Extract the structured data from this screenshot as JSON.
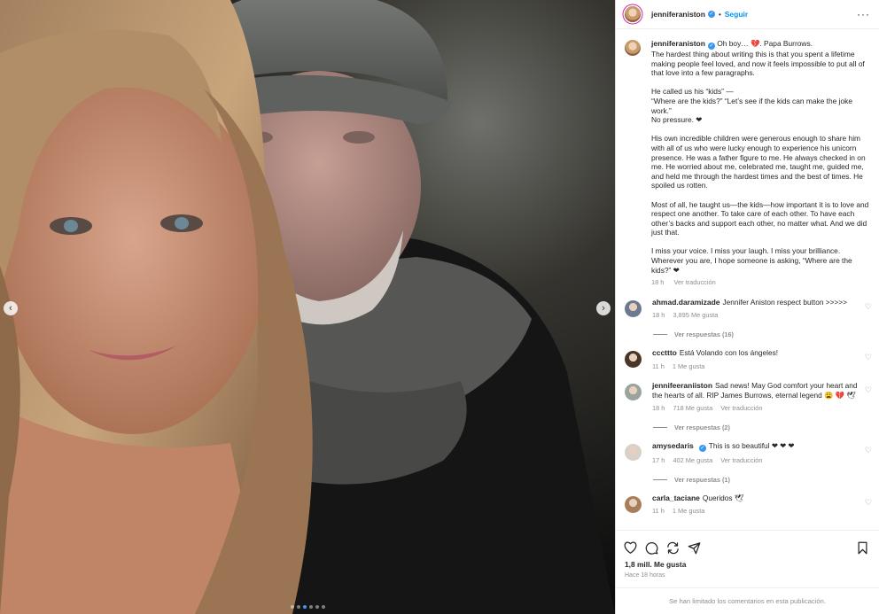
{
  "header": {
    "username": "jenniferaniston",
    "separator": "•",
    "follow_label": "Seguir",
    "more_label": "···"
  },
  "carousel": {
    "prev_label": "‹",
    "next_label": "›",
    "slide_count": 6,
    "active_slide": 2
  },
  "caption": {
    "username": "jenniferaniston",
    "paragraphs": [
      "Oh boy… 💔. Papa Burrows.\nThe hardest thing about writing this is that you spent a lifetime making people feel loved, and now it feels impossible to put all of that love into a few paragraphs.",
      "He called us his “kids” —\n“Where are the kids?” “Let’s see if the kids can make the joke work.”\nNo pressure. ❤",
      "His own incredible children were generous enough to share him with all of us who were lucky enough to experience his unicorn presence. He was a father figure to me. He always checked in on me. He worried about me, celebrated me, taught me, guided me, and held me through the hardest times and the best of times. He spoiled us rotten.",
      "Most of all, he taught us—the kids—how important it is to love and respect one another. To take care of each other. To have each other’s backs and support each other, no matter what. And we did just that.",
      "I miss your voice. I miss your laugh. I miss your brilliance. Wherever you are, I hope someone is asking, “Where are the kids?” ❤"
    ],
    "time": "18 h",
    "translate": "Ver traducción"
  },
  "comments": [
    {
      "username": "ahmad.daramizade",
      "text": "Jennifer Aniston respect button >>>>>",
      "time": "18 h",
      "likes": "3,895 Me gusta",
      "translate": "",
      "replies": "Ver respuestas (16)",
      "verified": false,
      "avatar_color": "#6b7a8f"
    },
    {
      "username": "cccttto",
      "text": "Está Volando con los ángeles!",
      "time": "11 h",
      "likes": "1 Me gusta",
      "translate": "",
      "replies": "",
      "verified": false,
      "avatar_color": "#4a3526"
    },
    {
      "username": "jennifeeraniiston",
      "text": "Sad news! May God comfort your heart and the hearts of all. RIP James Burrows, eternal legend 😩 💔 🕊",
      "time": "18 h",
      "likes": "718 Me gusta",
      "translate": "Ver traducción",
      "replies": "Ver respuestas (2)",
      "verified": false,
      "avatar_color": "#9aa39c"
    },
    {
      "username": "amysedaris",
      "text": "This is so beautiful ❤ ❤ ❤",
      "time": "17 h",
      "likes": "402 Me gusta",
      "translate": "Ver traducción",
      "replies": "Ver respuestas (1)",
      "verified": true,
      "avatar_color": "#d9d0c7"
    },
    {
      "username": "carla_taciane",
      "text": "Queridos 🕊",
      "time": "11 h",
      "likes": "1 Me gusta",
      "translate": "",
      "replies": "",
      "verified": false,
      "avatar_color": "#a87e5a"
    }
  ],
  "actions": {
    "likes": "1,8 mill. Me gusta",
    "time": "Hace 18 horas",
    "icons": [
      "heart-icon",
      "comment-icon",
      "share-icon",
      "send-icon",
      "bookmark-icon"
    ]
  },
  "footer": {
    "limited_text": "Se han limitado los comentarios en esta publicación."
  },
  "colors": {
    "accent": "#0095f6",
    "heart": "#e0245e",
    "verified": "#3897f0",
    "muted": "#8e8e8e"
  }
}
